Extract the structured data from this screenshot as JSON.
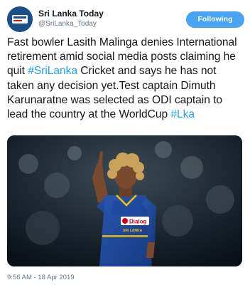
{
  "account": {
    "display_name": "Sri Lanka Today",
    "handle": "@SriLanka_Today"
  },
  "follow_button": {
    "label": "Following"
  },
  "tweet": {
    "text_part_1": "Fast bowler Lasith Malinga denies International retirement amid social media posts claiming he quit ",
    "hashtag_1": "#SriLanka",
    "text_part_2": " Cricket and says he has not taken any decision yet.Test captain Dimuth Karunaratne was selected as ODI captain to lead the country at the WorldCup ",
    "hashtag_2": "#Lka"
  },
  "photo": {
    "jersey_sponsor": "Dialog",
    "jersey_name": "SRI LANKA"
  },
  "timestamp": "9:56 AM - 18 Apr 2019",
  "colors": {
    "link": "#1da1f2",
    "button": "#4aa4f4",
    "secondary_text": "#657786"
  }
}
